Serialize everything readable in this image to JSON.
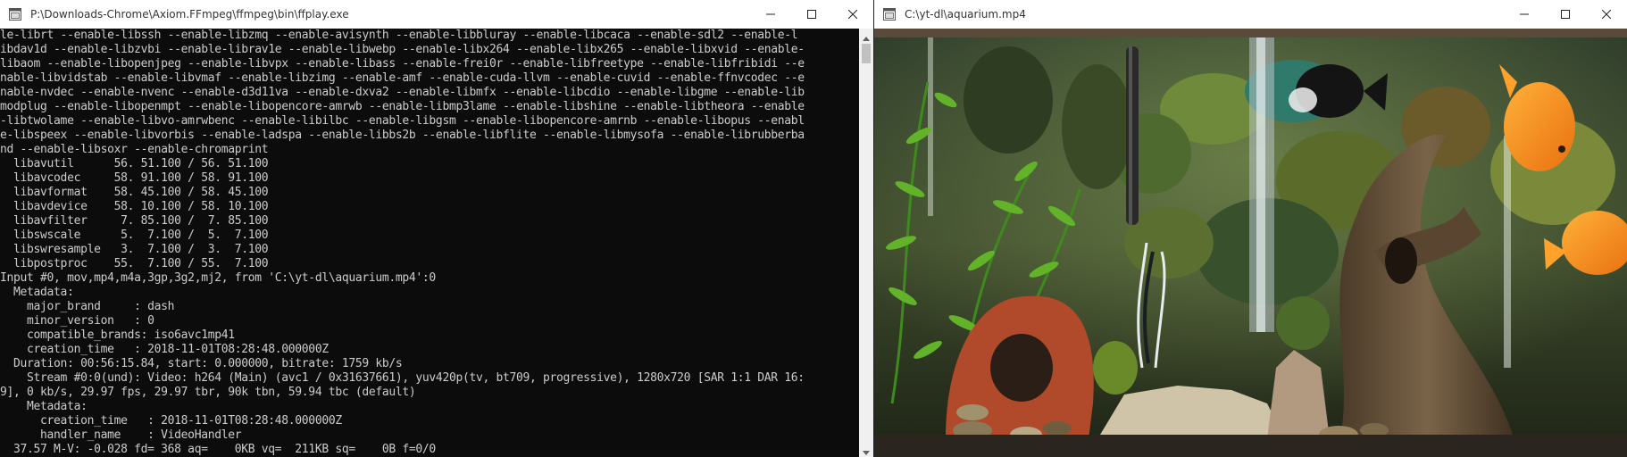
{
  "console_window": {
    "title": "P:\\Downloads-Chrome\\Axiom.FFmpeg\\ffmpeg\\bin\\ffplay.exe",
    "lines": [
      "le-librt --enable-libssh --enable-libzmq --enable-avisynth --enable-libbluray --enable-libcaca --enable-sdl2 --enable-l",
      "ibdav1d --enable-libzvbi --enable-librav1e --enable-libwebp --enable-libx264 --enable-libx265 --enable-libxvid --enable-",
      "libaom --enable-libopenjpeg --enable-libvpx --enable-libass --enable-frei0r --enable-libfreetype --enable-libfribidi --e",
      "nable-libvidstab --enable-libvmaf --enable-libzimg --enable-amf --enable-cuda-llvm --enable-cuvid --enable-ffnvcodec --e",
      "nable-nvdec --enable-nvenc --enable-d3d11va --enable-dxva2 --enable-libmfx --enable-libcdio --enable-libgme --enable-lib",
      "modplug --enable-libopenmpt --enable-libopencore-amrwb --enable-libmp3lame --enable-libshine --enable-libtheora --enable",
      "-libtwolame --enable-libvo-amrwbenc --enable-libilbc --enable-libgsm --enable-libopencore-amrnb --enable-libopus --enabl",
      "e-libspeex --enable-libvorbis --enable-ladspa --enable-libbs2b --enable-libflite --enable-libmysofa --enable-librubberba",
      "nd --enable-libsoxr --enable-chromaprint",
      "  libavutil      56. 51.100 / 56. 51.100",
      "  libavcodec     58. 91.100 / 58. 91.100",
      "  libavformat    58. 45.100 / 58. 45.100",
      "  libavdevice    58. 10.100 / 58. 10.100",
      "  libavfilter     7. 85.100 /  7. 85.100",
      "  libswscale      5.  7.100 /  5.  7.100",
      "  libswresample   3.  7.100 /  3.  7.100",
      "  libpostproc    55.  7.100 / 55.  7.100",
      "Input #0, mov,mp4,m4a,3gp,3g2,mj2, from 'C:\\yt-dl\\aquarium.mp4':0",
      "  Metadata:",
      "    major_brand     : dash",
      "    minor_version   : 0",
      "    compatible_brands: iso6avc1mp41",
      "    creation_time   : 2018-11-01T08:28:48.000000Z",
      "  Duration: 00:56:15.84, start: 0.000000, bitrate: 1759 kb/s",
      "    Stream #0:0(und): Video: h264 (Main) (avc1 / 0x31637661), yuv420p(tv, bt709, progressive), 1280x720 [SAR 1:1 DAR 16:",
      "9], 0 kb/s, 29.97 fps, 29.97 tbr, 90k tbn, 59.94 tbc (default)",
      "    Metadata:",
      "      creation_time   : 2018-11-01T08:28:48.000000Z",
      "      handler_name    : VideoHandler",
      "  37.57 M-V: -0.028 fd= 368 aq=    0KB vq=  211KB sq=    0B f=0/0"
    ]
  },
  "video_window": {
    "title": "C:\\yt-dl\\aquarium.mp4"
  },
  "colors": {
    "console_bg": "#0c0c0c",
    "console_fg": "#cccccc",
    "titlebar_bg": "#ffffff"
  },
  "icons": {
    "app": "app-window-icon",
    "minimize": "minimize-icon",
    "maximize": "maximize-icon",
    "close": "close-icon"
  }
}
